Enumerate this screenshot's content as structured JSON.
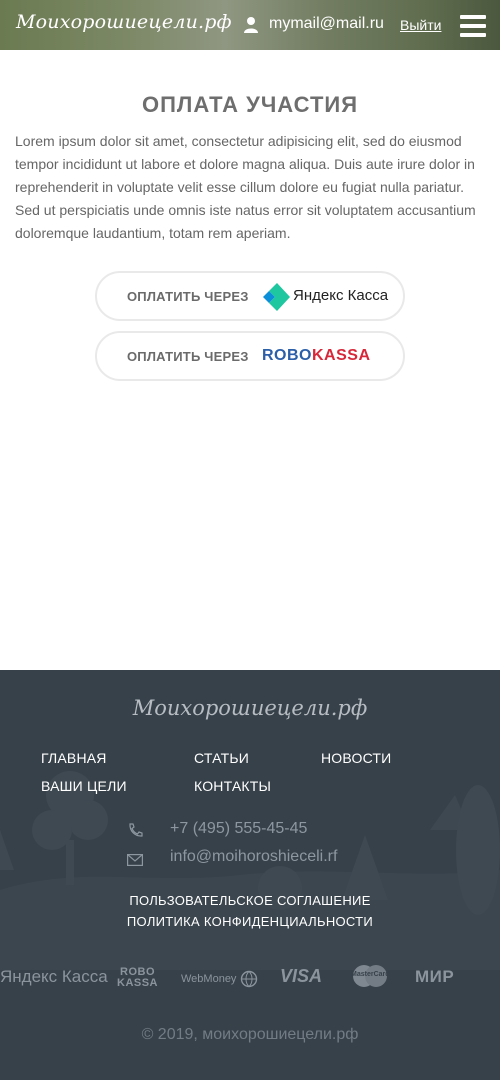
{
  "header": {
    "logo": "Моихорошиецели.рф",
    "user_email": "mymail@mail.ru",
    "logout_label": "Выйти",
    "user_icon": "user-icon",
    "menu_icon": "hamburger-menu-icon"
  },
  "main": {
    "title": "ОПЛАТА УЧАСТИЯ",
    "lead": "Lorem ipsum dolor sit amet, consectetur adipisicing elit, sed do eiusmod tempor incididunt ut labore et dolore magna aliqua. Duis aute irure dolor in reprehenderit in voluptate velit esse cillum dolore eu fugiat nulla pariatur. Sed ut perspiciatis unde omnis iste natus error sit voluptatem accusantium doloremque laudantium, totam rem aperiam.",
    "payment_buttons": [
      {
        "label": "ОПЛАТИТЬ ЧЕРЕЗ",
        "provider": "Яндекс Касса"
      },
      {
        "label": "ОПЛАТИТЬ ЧЕРЕЗ",
        "provider_part1": "ROBO",
        "provider_part2": "KASSA"
      }
    ]
  },
  "footer": {
    "logo": "Моихорошиецели.рф",
    "nav": [
      "ГЛАВНАЯ",
      "СТАТЬИ",
      "НОВОСТИ",
      "ВАШИ ЦЕЛИ",
      "КОНТАКТЫ"
    ],
    "phone": "+7 (495) 555-45-45",
    "email": "info@moihoroshieceli.rf",
    "legal": [
      "ПОЛЬЗОВАТЕЛЬСКОЕ СОГЛАШЕНИЕ",
      "ПОЛИТИКА КОНФИДЕНЦИАЛЬНОСТИ"
    ],
    "payment_logos": {
      "yandex": "Яндекс Касса",
      "robo_top": "ROBO",
      "robo_bottom": "KASSA",
      "webmoney": "WebMoney",
      "visa": "VISA",
      "mastercard": "MasterCard",
      "mir": "МИР"
    },
    "copyright": "© 2019, моихорошиецели.рф"
  },
  "colors": {
    "footer_bg": "#37414a",
    "robokassa_blue": "#2b5fa8",
    "robokassa_red": "#d6283a",
    "yandex_green": "#1fc7a0"
  }
}
